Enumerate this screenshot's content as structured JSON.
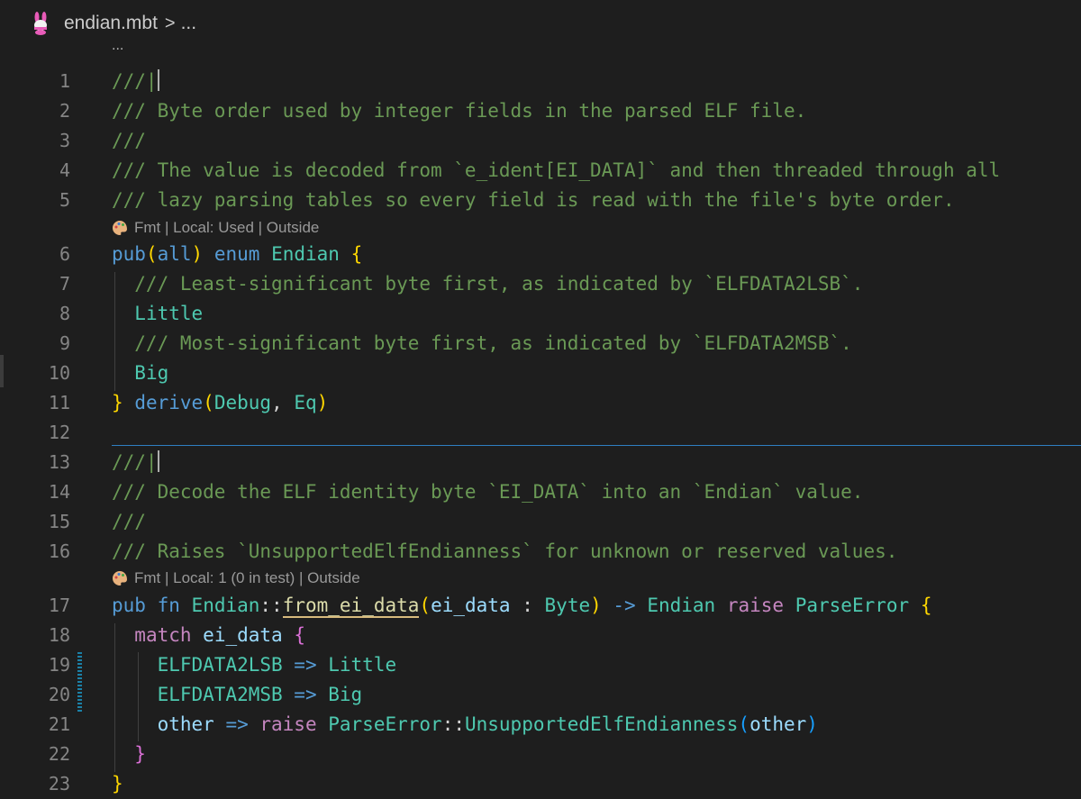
{
  "breadcrumb": {
    "icon": "moonbit-rabbit-icon",
    "file": "endian.mbt",
    "separator": ">",
    "more": "..."
  },
  "folded_indicator": "...",
  "code_lens": [
    {
      "icon": "palette-icon",
      "text": "Fmt | Local: Used | Outside"
    },
    {
      "icon": "palette-icon",
      "text": "Fmt | Local: 1 (0 in test) | Outside"
    }
  ],
  "lines": [
    {
      "num": "1",
      "tokens": [
        {
          "t": "///|",
          "c": "com"
        }
      ],
      "cursor": true
    },
    {
      "num": "2",
      "tokens": [
        {
          "t": "/// Byte order used by integer fields in the parsed ELF file.",
          "c": "com"
        }
      ]
    },
    {
      "num": "3",
      "tokens": [
        {
          "t": "///",
          "c": "com"
        }
      ]
    },
    {
      "num": "4",
      "tokens": [
        {
          "t": "/// The value is decoded from `e_ident[EI_DATA]` and then threaded through all",
          "c": "com"
        }
      ]
    },
    {
      "num": "5",
      "tokens": [
        {
          "t": "/// lazy parsing tables so every field is read with the file's byte order.",
          "c": "com"
        }
      ]
    },
    {
      "num": "6",
      "tokens": [
        {
          "t": "pub",
          "c": "kw"
        },
        {
          "t": "(",
          "c": "b1"
        },
        {
          "t": "all",
          "c": "kw"
        },
        {
          "t": ")",
          "c": "b1"
        },
        {
          "t": " ",
          "c": "op"
        },
        {
          "t": "enum",
          "c": "kw"
        },
        {
          "t": " ",
          "c": "op"
        },
        {
          "t": "Endian",
          "c": "type"
        },
        {
          "t": " ",
          "c": "op"
        },
        {
          "t": "{",
          "c": "b1"
        }
      ]
    },
    {
      "num": "7",
      "tokens": [
        {
          "t": "  /// Least-significant byte first, as indicated by `ELFDATA2LSB`.",
          "c": "com"
        }
      ]
    },
    {
      "num": "8",
      "tokens": [
        {
          "t": "  ",
          "c": "op"
        },
        {
          "t": "Little",
          "c": "type"
        }
      ]
    },
    {
      "num": "9",
      "tokens": [
        {
          "t": "  /// Most-significant byte first, as indicated by `ELFDATA2MSB`.",
          "c": "com"
        }
      ]
    },
    {
      "num": "10",
      "tokens": [
        {
          "t": "  ",
          "c": "op"
        },
        {
          "t": "Big",
          "c": "type"
        }
      ]
    },
    {
      "num": "11",
      "tokens": [
        {
          "t": "}",
          "c": "b1"
        },
        {
          "t": " ",
          "c": "op"
        },
        {
          "t": "derive",
          "c": "kw"
        },
        {
          "t": "(",
          "c": "b1"
        },
        {
          "t": "Debug",
          "c": "type"
        },
        {
          "t": ", ",
          "c": "op"
        },
        {
          "t": "Eq",
          "c": "type"
        },
        {
          "t": ")",
          "c": "b1"
        }
      ]
    },
    {
      "num": "12",
      "tokens": []
    },
    {
      "num": "13",
      "tokens": [
        {
          "t": "///|",
          "c": "com"
        }
      ],
      "cursor": true
    },
    {
      "num": "14",
      "tokens": [
        {
          "t": "/// Decode the ELF identity byte `EI_DATA` into an `Endian` value.",
          "c": "com"
        }
      ]
    },
    {
      "num": "15",
      "tokens": [
        {
          "t": "///",
          "c": "com"
        }
      ]
    },
    {
      "num": "16",
      "tokens": [
        {
          "t": "/// Raises `UnsupportedElfEndianness` for unknown or reserved values.",
          "c": "com"
        }
      ]
    },
    {
      "num": "17",
      "tokens": [
        {
          "t": "pub",
          "c": "kw"
        },
        {
          "t": " ",
          "c": "op"
        },
        {
          "t": "fn",
          "c": "kw"
        },
        {
          "t": " ",
          "c": "op"
        },
        {
          "t": "Endian",
          "c": "type"
        },
        {
          "t": "::",
          "c": "op"
        },
        {
          "t": "from_ei_data",
          "c": "fn",
          "u": true
        },
        {
          "t": "(",
          "c": "b1"
        },
        {
          "t": "ei_data",
          "c": "var"
        },
        {
          "t": " : ",
          "c": "op"
        },
        {
          "t": "Byte",
          "c": "type"
        },
        {
          "t": ")",
          "c": "b1"
        },
        {
          "t": " -> ",
          "c": "kw"
        },
        {
          "t": "Endian",
          "c": "type"
        },
        {
          "t": " ",
          "c": "op"
        },
        {
          "t": "raise",
          "c": "ctl"
        },
        {
          "t": " ",
          "c": "op"
        },
        {
          "t": "ParseError",
          "c": "type"
        },
        {
          "t": " ",
          "c": "op"
        },
        {
          "t": "{",
          "c": "b1"
        }
      ]
    },
    {
      "num": "18",
      "tokens": [
        {
          "t": "  ",
          "c": "op"
        },
        {
          "t": "match",
          "c": "ctl"
        },
        {
          "t": " ",
          "c": "op"
        },
        {
          "t": "ei_data",
          "c": "var"
        },
        {
          "t": " ",
          "c": "op"
        },
        {
          "t": "{",
          "c": "b2"
        }
      ]
    },
    {
      "num": "19",
      "tokens": [
        {
          "t": "    ",
          "c": "op"
        },
        {
          "t": "ELFDATA2LSB",
          "c": "type"
        },
        {
          "t": " => ",
          "c": "kw"
        },
        {
          "t": "Little",
          "c": "type"
        }
      ]
    },
    {
      "num": "20",
      "tokens": [
        {
          "t": "    ",
          "c": "op"
        },
        {
          "t": "ELFDATA2MSB",
          "c": "type"
        },
        {
          "t": " => ",
          "c": "kw"
        },
        {
          "t": "Big",
          "c": "type"
        }
      ]
    },
    {
      "num": "21",
      "tokens": [
        {
          "t": "    ",
          "c": "op"
        },
        {
          "t": "other",
          "c": "var"
        },
        {
          "t": " => ",
          "c": "kw"
        },
        {
          "t": "raise",
          "c": "ctl"
        },
        {
          "t": " ",
          "c": "op"
        },
        {
          "t": "ParseError",
          "c": "type"
        },
        {
          "t": "::",
          "c": "op"
        },
        {
          "t": "UnsupportedElfEndianness",
          "c": "type"
        },
        {
          "t": "(",
          "c": "b3"
        },
        {
          "t": "other",
          "c": "var"
        },
        {
          "t": ")",
          "c": "b3"
        }
      ]
    },
    {
      "num": "22",
      "tokens": [
        {
          "t": "  ",
          "c": "op"
        },
        {
          "t": "}",
          "c": "b2"
        }
      ]
    },
    {
      "num": "23",
      "tokens": [
        {
          "t": "}",
          "c": "b1"
        }
      ]
    }
  ]
}
